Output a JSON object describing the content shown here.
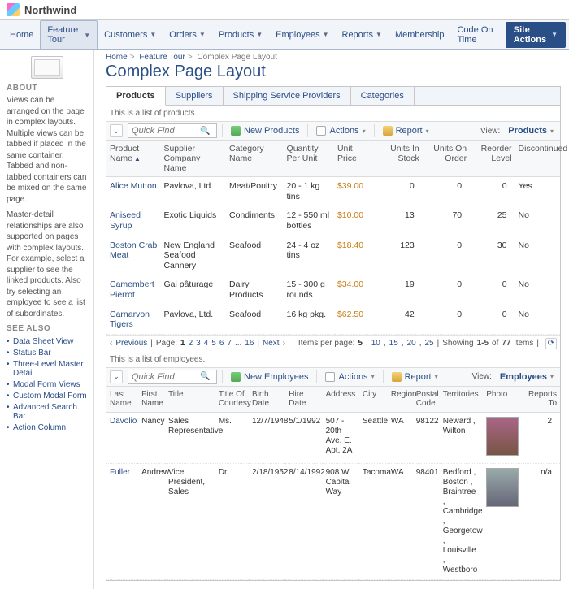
{
  "app": {
    "title": "Northwind"
  },
  "menu": {
    "items": [
      {
        "label": "Home",
        "caret": false
      },
      {
        "label": "Feature Tour",
        "caret": true,
        "active": true
      },
      {
        "label": "Customers",
        "caret": true
      },
      {
        "label": "Orders",
        "caret": true
      },
      {
        "label": "Products",
        "caret": true
      },
      {
        "label": "Employees",
        "caret": true
      },
      {
        "label": "Reports",
        "caret": true
      },
      {
        "label": "Membership",
        "caret": false
      },
      {
        "label": "Code On Time",
        "caret": false
      }
    ],
    "site_actions": "Site Actions"
  },
  "sidebar": {
    "about_h": "ABOUT",
    "about_p1": "Views can be arranged on the page in complex layouts. Multiple views can be tabbed if placed in the same container. Tabbed and non-tabbed containers can be mixed on the same page.",
    "about_p2": "Master-detail relationships are also supported on pages with complex layouts. For example, select a supplier to see the linked products. Also try selecting an employee to see a list of subordinates.",
    "see_also_h": "SEE ALSO",
    "see_also": [
      "Data Sheet View",
      "Status Bar",
      "Three-Level Master Detail",
      "Modal Form Views",
      "Custom Modal Form",
      "Advanced Search Bar",
      "Action Column"
    ]
  },
  "breadcrumbs": {
    "a": "Home",
    "b": "Feature Tour",
    "c": "Complex Page Layout"
  },
  "page_title": "Complex Page Layout",
  "tabs": [
    "Products",
    "Suppliers",
    "Shipping Service Providers",
    "Categories"
  ],
  "products": {
    "list_label": "This is a list of products.",
    "quickfind_placeholder": "Quick Find",
    "new_btn": "New Products",
    "actions_btn": "Actions",
    "report_btn": "Report",
    "view_label": "View:",
    "view_value": "Products",
    "cols": [
      "Product Name",
      "Supplier Company Name",
      "Category Name",
      "Quantity Per Unit",
      "Unit Price",
      "Units In Stock",
      "Units On Order",
      "Reorder Level",
      "Discontinued"
    ],
    "rows": [
      {
        "name": "Alice Mutton",
        "supplier": "Pavlova, Ltd.",
        "category": "Meat/Poultry",
        "qpu": "20 - 1 kg tins",
        "price": "$39.00",
        "stock": "0",
        "order": "0",
        "reorder": "0",
        "disc": "Yes"
      },
      {
        "name": "Aniseed Syrup",
        "supplier": "Exotic Liquids",
        "category": "Condiments",
        "qpu": "12 - 550 ml bottles",
        "price": "$10.00",
        "stock": "13",
        "order": "70",
        "reorder": "25",
        "disc": "No"
      },
      {
        "name": "Boston Crab Meat",
        "supplier": "New England Seafood Cannery",
        "category": "Seafood",
        "qpu": "24 - 4 oz tins",
        "price": "$18.40",
        "stock": "123",
        "order": "0",
        "reorder": "30",
        "disc": "No"
      },
      {
        "name": "Camembert Pierrot",
        "supplier": "Gai pâturage",
        "category": "Dairy Products",
        "qpu": "15 - 300 g rounds",
        "price": "$34.00",
        "stock": "19",
        "order": "0",
        "reorder": "0",
        "disc": "No"
      },
      {
        "name": "Carnarvon Tigers",
        "supplier": "Pavlova, Ltd.",
        "category": "Seafood",
        "qpu": "16 kg pkg.",
        "price": "$62.50",
        "stock": "42",
        "order": "0",
        "reorder": "0",
        "disc": "No"
      }
    ],
    "pager": {
      "prev": "Previous",
      "page_lbl": "Page:",
      "pages": [
        "1",
        "2",
        "3",
        "4",
        "5",
        "6",
        "7"
      ],
      "ell": "...",
      "last": "16",
      "next": "Next",
      "ipp_lbl": "Items per page:",
      "ipp_opts": [
        "5",
        "10",
        "15",
        "20",
        "25"
      ],
      "showing": "Showing",
      "range": "1-5",
      "of": "of",
      "total": "77",
      "items": "items"
    }
  },
  "employees": {
    "list_label": "This is a list of employees.",
    "quickfind_placeholder": "Quick Find",
    "new_btn": "New Employees",
    "actions_btn": "Actions",
    "report_btn": "Report",
    "view_label": "View:",
    "view_value": "Employees",
    "cols": [
      "Last Name",
      "First Name",
      "Title",
      "Title Of Courtesy",
      "Birth Date",
      "Hire Date",
      "Address",
      "City",
      "Region",
      "Postal Code",
      "Territories",
      "Photo",
      "Reports To"
    ],
    "rows": [
      {
        "last": "Davolio",
        "first": "Nancy",
        "title": "Sales Representative",
        "toc": "Ms.",
        "bd": "12/7/1948",
        "hd": "5/1/1992",
        "addr": "507 - 20th Ave. E. Apt. 2A",
        "city": "Seattle",
        "region": "WA",
        "postal": "98122",
        "terr": "Neward , Wilton",
        "reports": "2"
      },
      {
        "last": "Fuller",
        "first": "Andrew",
        "title": "Vice President, Sales",
        "toc": "Dr.",
        "bd": "2/18/1952",
        "hd": "8/14/1992",
        "addr": "908 W. Capital Way",
        "city": "Tacoma",
        "region": "WA",
        "postal": "98401",
        "terr": "Bedford , Boston , Braintree , Cambridge , Georgetow , Louisville , Westboro",
        "reports": "n/a"
      }
    ]
  }
}
